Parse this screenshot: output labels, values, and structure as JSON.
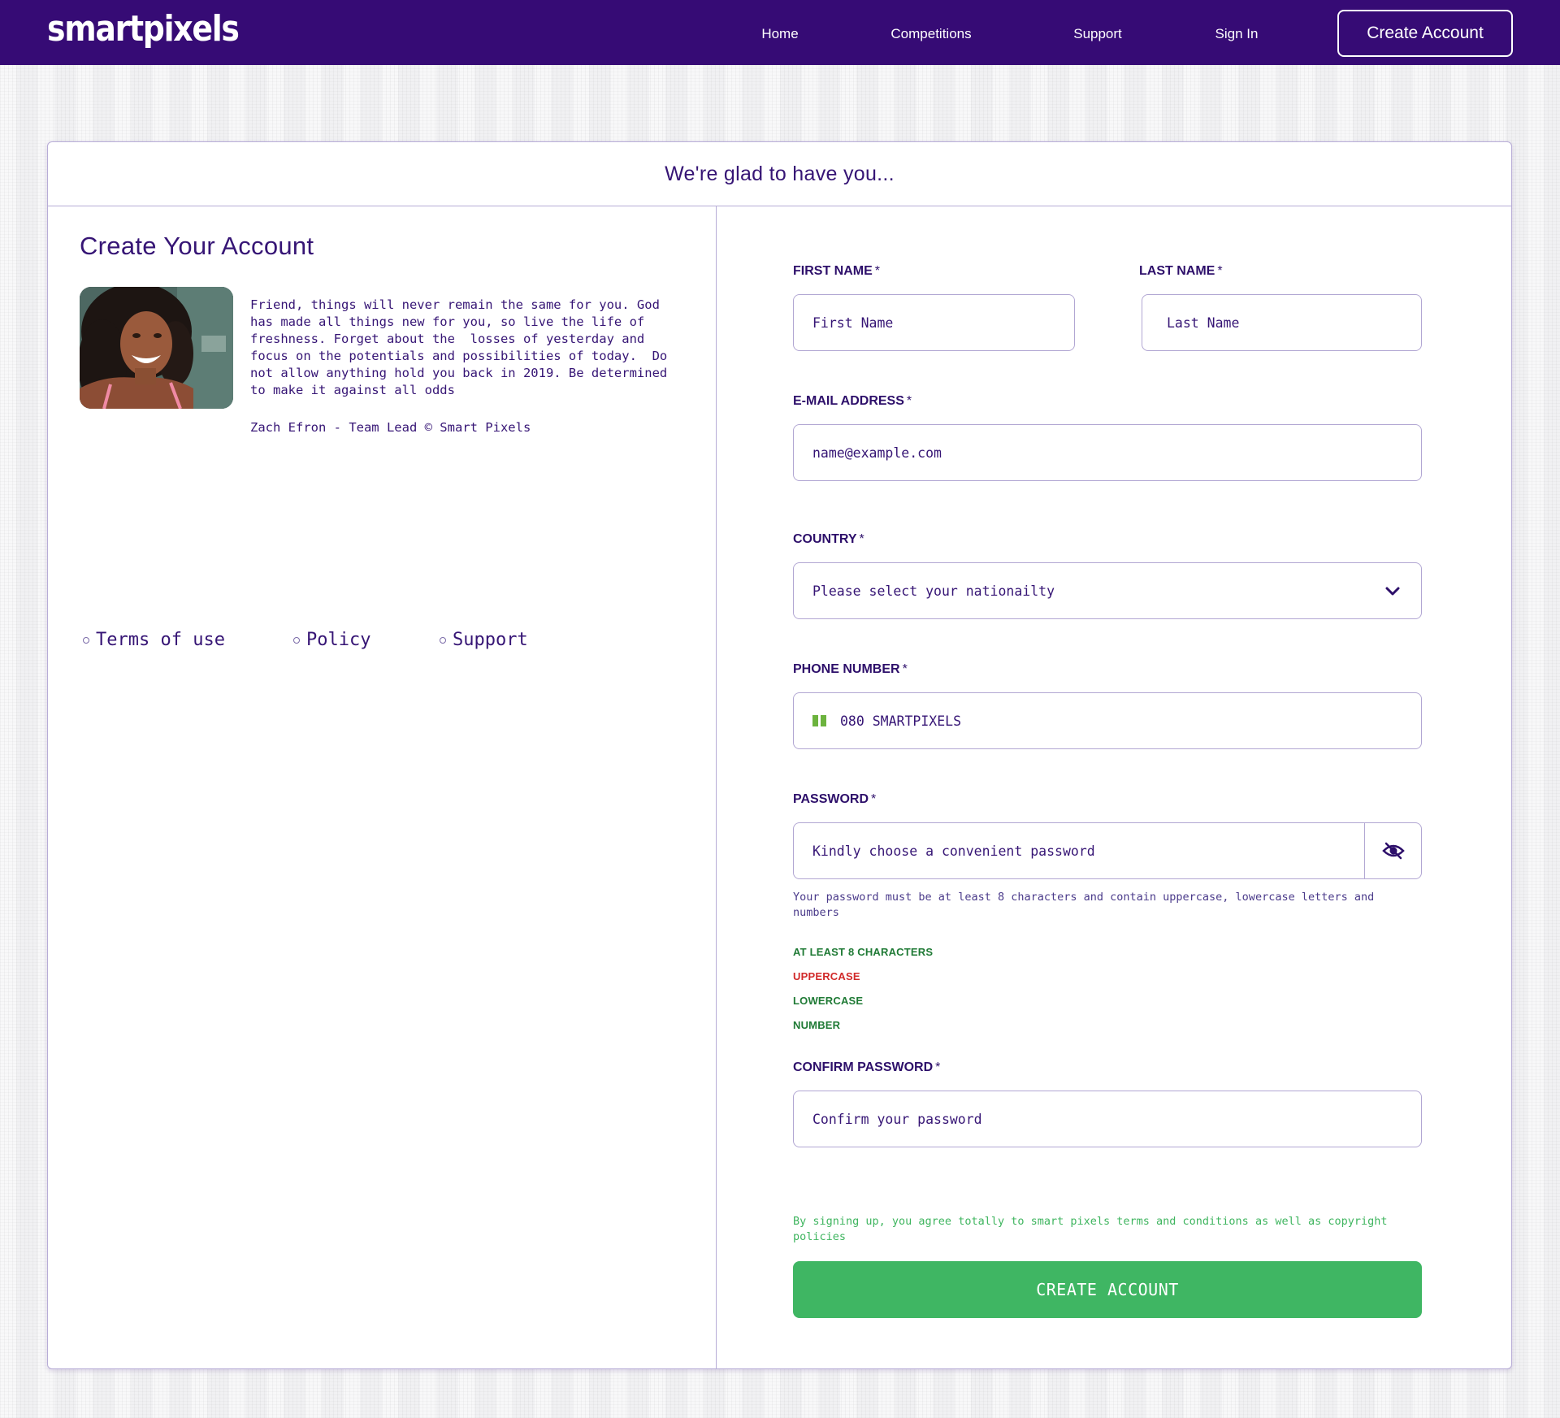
{
  "header": {
    "logo": "smartpixels",
    "nav": [
      "Home",
      "Competitions",
      "Support",
      "Sign In"
    ],
    "cta": "Create Account"
  },
  "card": {
    "title": "We're glad to have you..."
  },
  "left": {
    "heading": "Create Your Account",
    "quote": "Friend, things will never remain the same for you. God\nhas made all things new for you, so live the life of\nfreshness. Forget about the  losses of yesterday and\nfocus on the potentials and possibilities of today.  Do\nnot allow anything hold you back in 2019. Be determined\nto make it against all odds",
    "author": "Zach Efron - Team Lead © Smart Pixels",
    "links": [
      "Terms of use",
      "Policy",
      "Support"
    ]
  },
  "form": {
    "first_name": {
      "label": "FIRST NAME",
      "placeholder": "First Name"
    },
    "last_name": {
      "label": "LAST NAME",
      "placeholder": "Last Name"
    },
    "email": {
      "label": "E-MAIL ADDRESS",
      "placeholder": "name@example.com"
    },
    "country": {
      "label": "COUNTRY",
      "placeholder": "Please select your nationailty"
    },
    "phone": {
      "label": "PHONE NUMBER",
      "placeholder": "080 SMARTPIXELS"
    },
    "password": {
      "label": "PASSWORD",
      "placeholder": "Kindly choose a convenient password",
      "helper": "Your password must be at least 8 characters and contain uppercase, lowercase letters and numbers",
      "rules": [
        {
          "text": "AT LEAST 8 CHARACTERS",
          "color": "#1f7a35"
        },
        {
          "text": "UPPERCASE",
          "color": "#d12a2a"
        },
        {
          "text": "LOWERCASE",
          "color": "#1f7a35"
        },
        {
          "text": "NUMBER",
          "color": "#1f7a35"
        }
      ]
    },
    "confirm_password": {
      "label": "CONFIRM PASSWORD",
      "placeholder": "Confirm your password"
    },
    "required_marker": "*",
    "terms": "By signing up, you agree totally to smart pixels terms and conditions as well as copyright policies",
    "submit": "CREATE ACCOUNT"
  },
  "colors": {
    "brand": "#360b75",
    "success": "#3fb663",
    "error": "#d12a2a"
  },
  "icons": {
    "country_select": "chevron-down-icon",
    "password_toggle": "eye-slash-icon",
    "phone_flag": "nigeria-flag-icon"
  }
}
